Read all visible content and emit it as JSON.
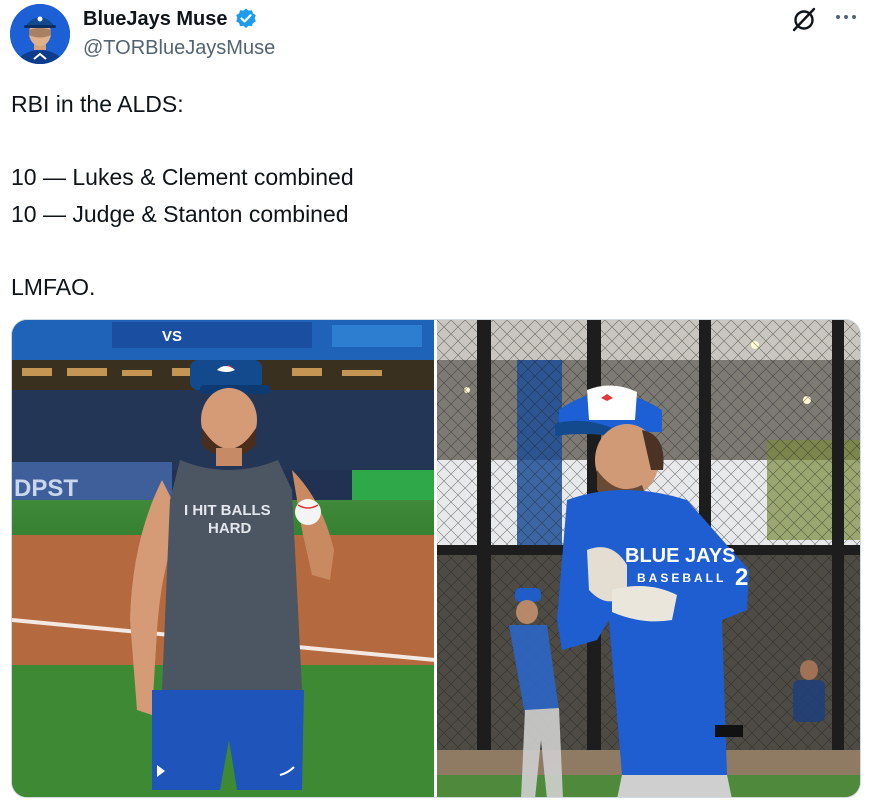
{
  "author": {
    "display_name": "BlueJays Muse",
    "handle": "@TORBlueJaysMuse",
    "verified": true,
    "avatar_icon": "profile-avatar",
    "verified_icon": "verified-badge-icon"
  },
  "header_actions": {
    "grok_icon": "grok-icon",
    "more_icon": "more-options-icon"
  },
  "tweet": {
    "lines": [
      "RBI in the ALDS:",
      "",
      "10 — Lukes & Clement combined",
      "10 — Judge & Stanton combined",
      "",
      "LMFAO."
    ]
  },
  "media": {
    "photo_left": {
      "shirt_text_line1": "I HIT BALLS",
      "shirt_text_line2": "HARD",
      "stadium_sign": "DPST",
      "scoreboard_text": "VS"
    },
    "photo_right": {
      "shirt_text": "BLUE JAYS",
      "shirt_subtext": "BASEBALL",
      "sleeve_number": "2"
    }
  },
  "colors": {
    "text_primary": "#0f1419",
    "text_secondary": "#536471",
    "verified_blue": "#1d9bf0",
    "blue_jays_blue": "#134a8e",
    "royal_blue": "#1d5fd4"
  }
}
